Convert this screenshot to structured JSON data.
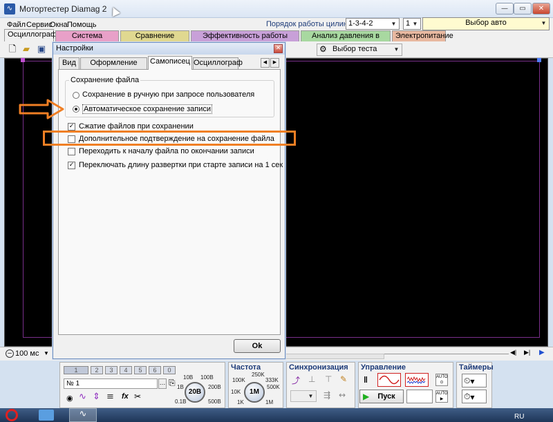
{
  "window": {
    "title": "Мотортестер Diamag 2",
    "icon": "app-waveform-icon"
  },
  "menu": {
    "items": [
      "Файл",
      "Сервис",
      "Окна",
      "Помощь"
    ]
  },
  "cylinder_order": {
    "label": "Порядок работы цилиндров",
    "value": "1-3-4-2",
    "count": "1",
    "auto_label": "Выбор авто"
  },
  "main_tabs": [
    {
      "label": "Осциллограф",
      "color": "#f0f0f0"
    },
    {
      "label": "Система зажигания",
      "color": "#e8a0c8"
    },
    {
      "label": "Сравнение цилиндров",
      "color": "#e0d890"
    },
    {
      "label": "Эффективность работы цилиндров",
      "color": "#c8a0d8"
    },
    {
      "label": "Анализ давления в цилиндре",
      "color": "#a8d8a0"
    },
    {
      "label": "Электропитание",
      "color": "#e8b8a0"
    }
  ],
  "toolbar": {
    "test_select": "Выбор теста"
  },
  "timebase": {
    "value": "100 мс"
  },
  "bottom": {
    "channels": [
      "1",
      "2",
      "3",
      "4",
      "5",
      "6",
      "0"
    ],
    "probe_value": "№ 1",
    "volt_knob": "20В",
    "volt_scale": [
      "10В",
      "100В",
      "1В",
      "200В",
      "0.1В",
      "500В"
    ],
    "freq_title": "Частота",
    "freq_knob": "1М",
    "freq_scale": [
      "250K",
      "100K",
      "333K",
      "10K",
      "500K",
      "1K",
      "1M"
    ],
    "sync_title": "Синхронизация",
    "control_title": "Управление",
    "start_label": "Пуск",
    "timers_title": "Таймеры"
  },
  "dialog": {
    "title": "Настройки",
    "tabs": [
      "Вид",
      "Оформление общее",
      "Самописец",
      "Осциллограф"
    ],
    "active_tab": "Самописец",
    "group_title": "Сохранение файла",
    "radios": [
      {
        "label": "Сохранение в ручную при запросе пользователя",
        "checked": false
      },
      {
        "label": "Автоматическое сохранение записи",
        "checked": true
      }
    ],
    "checks": [
      {
        "label": "Сжатие файлов при сохранении",
        "checked": true
      },
      {
        "label": "Дополнительное подтверждение на сохранение файла",
        "checked": false
      },
      {
        "label": "Переходить к началу  файла по окончании записи",
        "checked": false
      },
      {
        "label": "Переключать длину развертки при старте записи на 1 сек",
        "checked": true
      }
    ],
    "ok_label": "Ok"
  },
  "taskbar": {
    "lang": "RU"
  },
  "colors": {
    "annotation": "#f07f24",
    "scope_bg": "#000000",
    "scope_frame": "#7a2f8c"
  }
}
